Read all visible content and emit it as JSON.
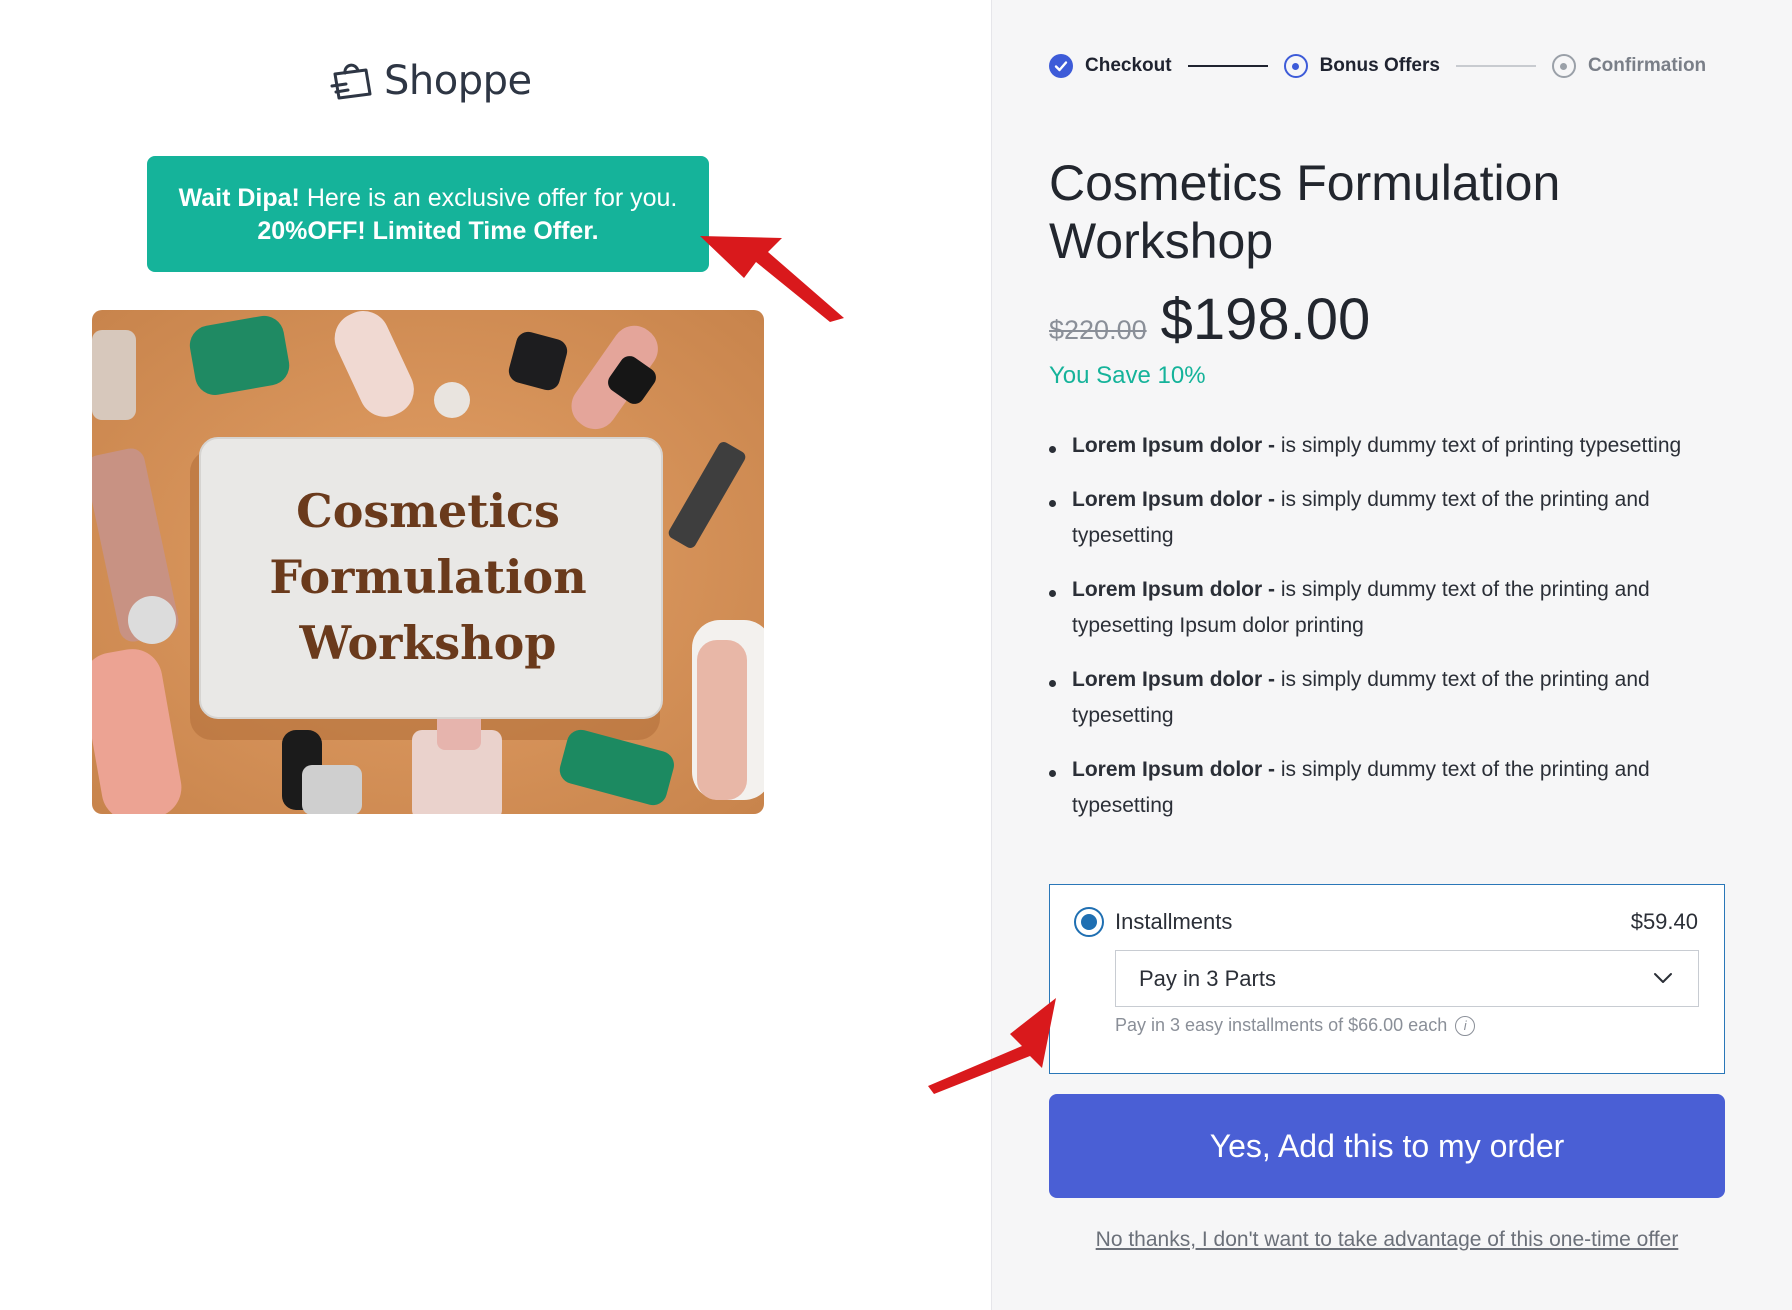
{
  "logo": {
    "text": "Shoppe",
    "icon": "shopping-bag-icon"
  },
  "banner": {
    "greeting": "Wait Dipa!",
    "message": " Here is an exclusive offer for you.",
    "offer": "20%OFF! Limited Time Offer."
  },
  "product_image": {
    "card_line1": "Cosmetics",
    "card_line2": "Formulation",
    "card_line3": "Workshop"
  },
  "stepper": {
    "steps": [
      {
        "label": "Checkout",
        "state": "done"
      },
      {
        "label": "Bonus Offers",
        "state": "current"
      },
      {
        "label": "Confirmation",
        "state": "todo"
      }
    ]
  },
  "product": {
    "title": "Cosmetics Formulation Workshop",
    "old_price": "$220.00",
    "new_price": "$198.00",
    "savings": "You Save 10%"
  },
  "features": [
    {
      "bold": "Lorem Ipsum dolor -",
      "text": " is simply dummy text of printing typesetting"
    },
    {
      "bold": "Lorem Ipsum dolor -",
      "text": " is simply dummy text of the printing and typesetting"
    },
    {
      "bold": "Lorem Ipsum dolor -",
      "text": " is simply dummy text of the printing and typesetting Ipsum dolor printing"
    },
    {
      "bold": "Lorem Ipsum dolor -",
      "text": " is simply dummy text of the printing and typesetting"
    },
    {
      "bold": "Lorem Ipsum dolor -",
      "text": " is simply dummy text of the printing and typesetting"
    }
  ],
  "payment": {
    "option_label": "Installments",
    "option_amount": "$59.40",
    "selected": true,
    "select_value": "Pay in 3 Parts",
    "note": "Pay in 3 easy installments of $66.00 each",
    "info_icon": "i"
  },
  "cta": {
    "label": "Yes, Add this to my order"
  },
  "decline": {
    "label": "No thanks, I don't want to take advantage of this one-time offer"
  },
  "colors": {
    "accent": "#4a5fd5",
    "banner": "#15b39a",
    "savings": "#15b39a",
    "annotation_arrow": "#d9191c"
  }
}
